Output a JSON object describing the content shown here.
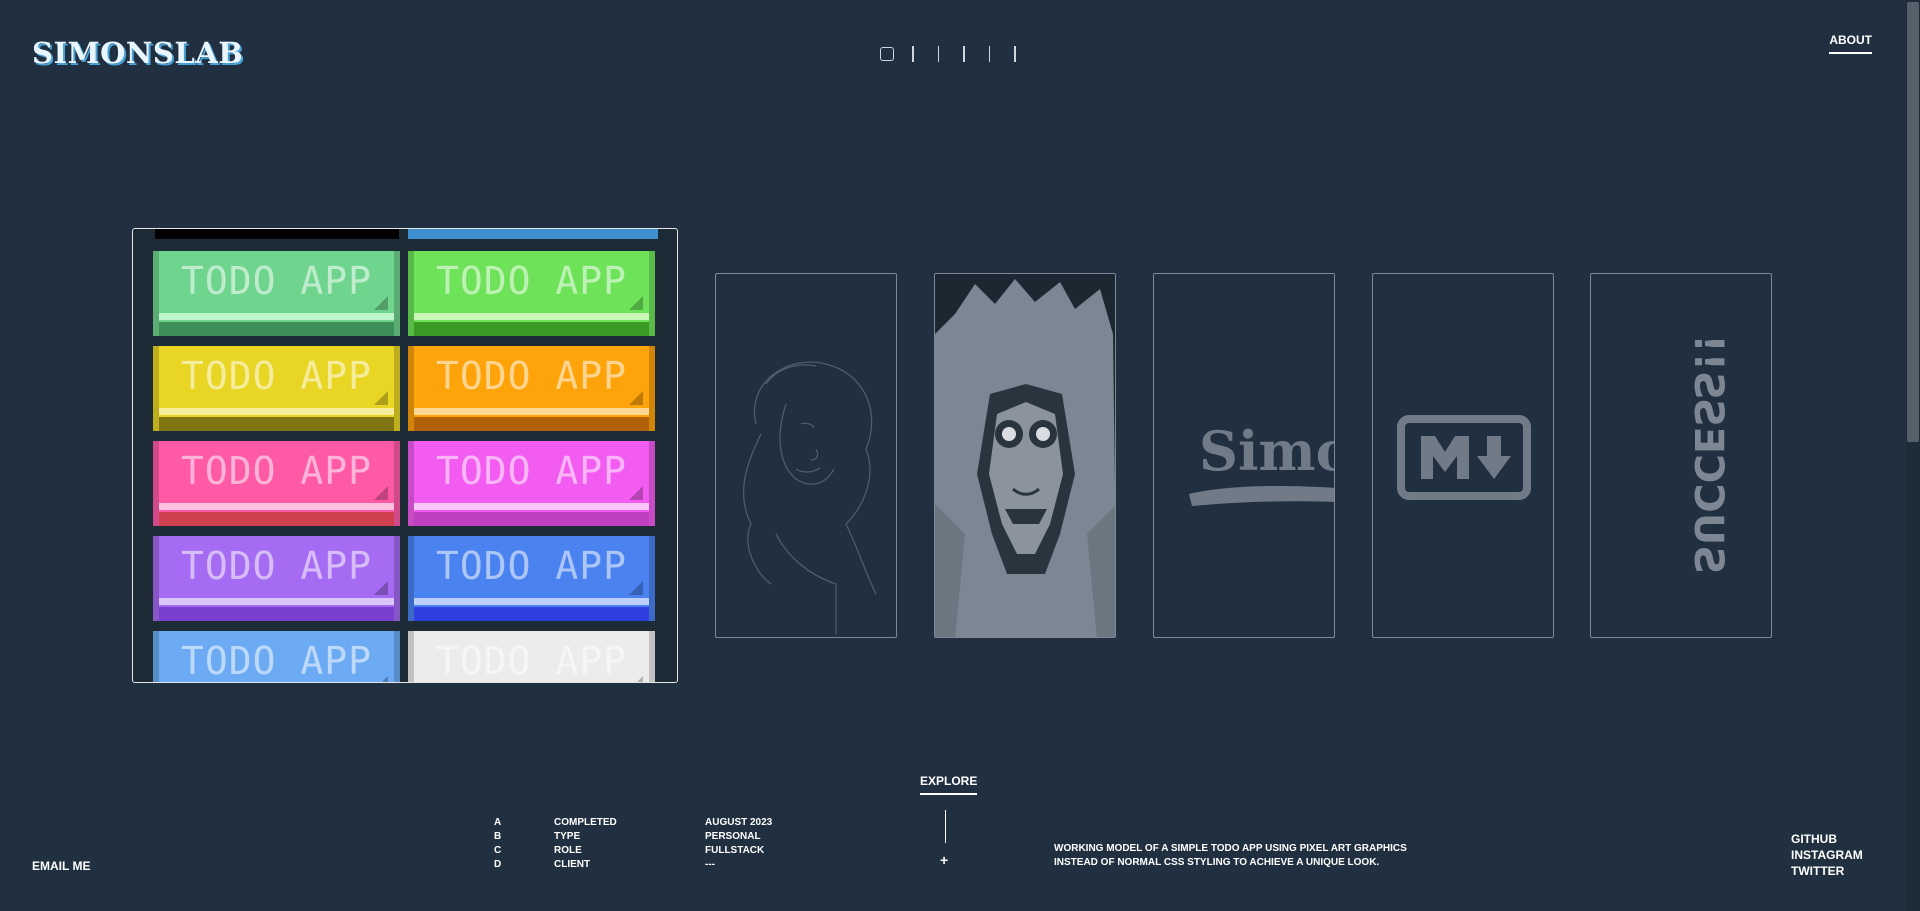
{
  "header": {
    "logo": "SIMONSLAB",
    "about_label": "ABOUT",
    "pager": {
      "total": 6,
      "active": 0
    }
  },
  "featured": {
    "name": "TODO APP",
    "button_label": "TODO APP",
    "tiles": [
      {
        "color": "#6fd48e",
        "shine": "#bff5cc",
        "base": "#3f8f5a"
      },
      {
        "color": "#6ee35a",
        "shine": "#c8f7b8",
        "base": "#3a9a24"
      },
      {
        "color": "#e8d524",
        "shine": "#f6ec9c",
        "base": "#7e7412"
      },
      {
        "color": "#ffa30a",
        "shine": "#ffd793",
        "base": "#b2610b"
      },
      {
        "color": "#ff5aa6",
        "shine": "#ffc0dd",
        "base": "#d04050"
      },
      {
        "color": "#f25cf0",
        "shine": "#f9c6f8",
        "base": "#c040c0"
      },
      {
        "color": "#a56bf2",
        "shine": "#dac6fb",
        "base": "#7b3fd0"
      },
      {
        "color": "#4a82f0",
        "shine": "#bcd0fb",
        "base": "#2f3fe0"
      },
      {
        "color": "#6cabf3",
        "shine": "#c4ddfb",
        "base": "#3a5fe0"
      },
      {
        "color": "#ececec",
        "shine": "#ffffff",
        "base": "#9a9a9a"
      }
    ]
  },
  "projects": [
    {
      "name": "sketch-portrait-card"
    },
    {
      "name": "hooded-figure-card"
    },
    {
      "name": "simonslab-brush-logo-card",
      "logo_text": "Simon"
    },
    {
      "name": "markdown-card",
      "logo_text": "M↓"
    },
    {
      "name": "success-card",
      "logo_text": "SUCCESS!!"
    }
  ],
  "explore": {
    "label": "EXPLORE",
    "plus": "+"
  },
  "meta": {
    "rows": [
      {
        "key": "A",
        "label": "COMPLETED",
        "value": "AUGUST 2023"
      },
      {
        "key": "B",
        "label": "TYPE",
        "value": "PERSONAL"
      },
      {
        "key": "C",
        "label": "ROLE",
        "value": "FULLSTACK"
      },
      {
        "key": "D",
        "label": "CLIENT",
        "value": "---"
      }
    ]
  },
  "description": {
    "line1": "WORKING MODEL OF A SIMPLE TODO APP USING PIXEL ART GRAPHICS",
    "line2": "INSTEAD OF NORMAL CSS STYLING TO ACHIEVE A UNIQUE LOOK."
  },
  "footer": {
    "email": "EMAIL ME",
    "social": [
      "GITHUB",
      "INSTAGRAM",
      "TWITTER"
    ]
  },
  "colors": {
    "background": "#213040",
    "text": "#ffffff",
    "card_border": "#7d8a96",
    "card_art": "#7d8793"
  }
}
